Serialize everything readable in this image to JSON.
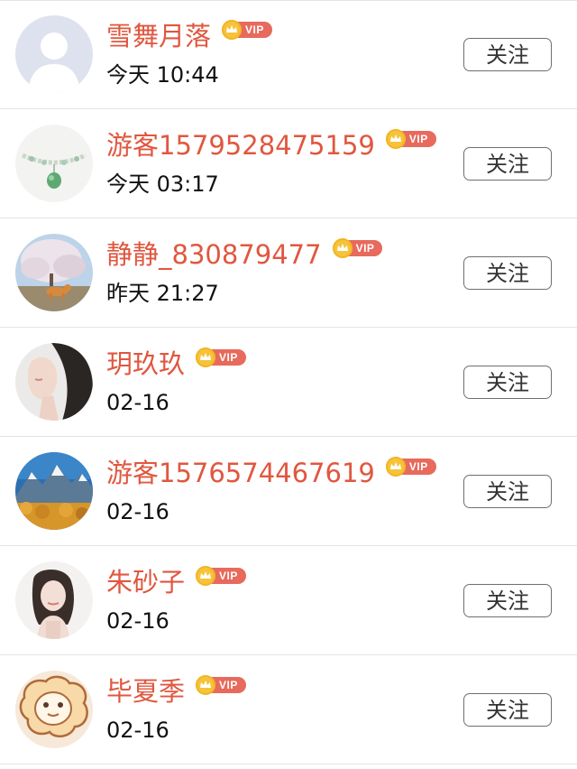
{
  "vip_label": "VIP",
  "follow_label": "关注",
  "colors": {
    "name": "#e0573f",
    "vip_badge": "#e76a5c",
    "crown": "#f6c33b",
    "divider": "#e4e4e4"
  },
  "users": [
    {
      "name": "雪舞月落",
      "time": "今天 10:44",
      "avatar": "default-avatar-icon"
    },
    {
      "name": "游客1579528475159",
      "time": "今天 03:17",
      "avatar": "bracelet-photo"
    },
    {
      "name": "静静_830879477",
      "time": "昨天 21:27",
      "avatar": "dog-tree-photo"
    },
    {
      "name": "玥玖玖",
      "time": "02-16",
      "avatar": "woman-portrait-photo"
    },
    {
      "name": "游客1576574467619",
      "time": "02-16",
      "avatar": "mountain-landscape-photo"
    },
    {
      "name": "朱砂子",
      "time": "02-16",
      "avatar": "woman-portrait-photo"
    },
    {
      "name": "毕夏季",
      "time": "02-16",
      "avatar": "cartoon-sheep-icon"
    }
  ]
}
